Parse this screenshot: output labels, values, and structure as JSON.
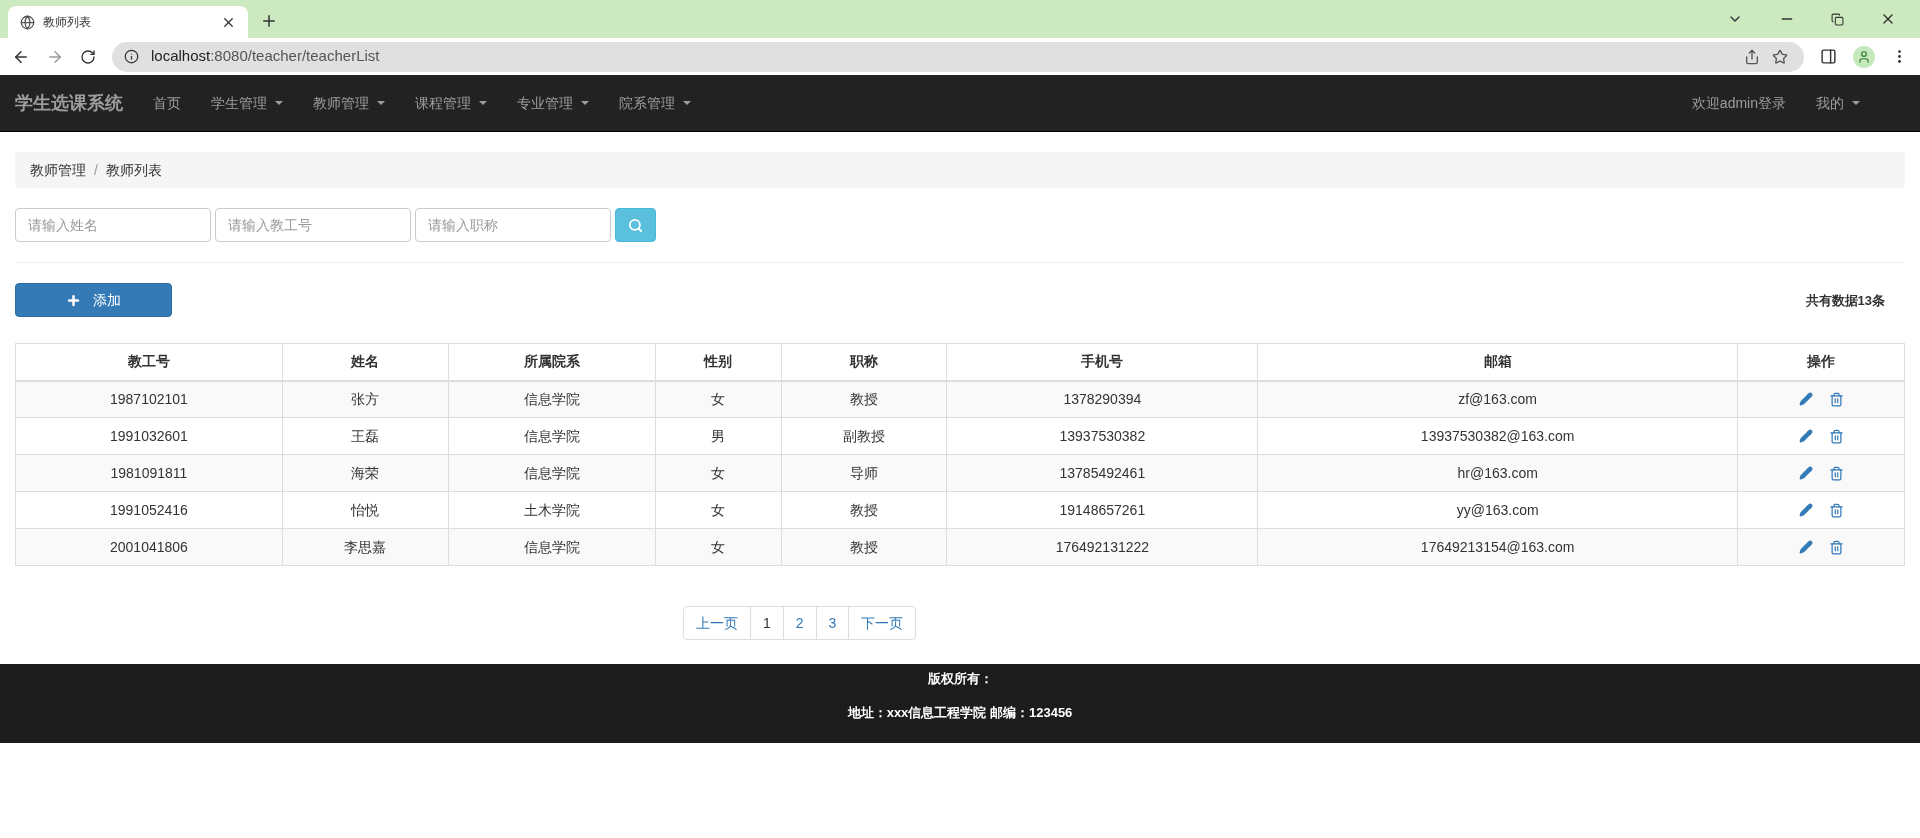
{
  "browser": {
    "tab_title": "教师列表",
    "url_host": "localhost",
    "url_path": ":8080/teacher/teacherList"
  },
  "navbar": {
    "brand": "学生选课系统",
    "items": [
      {
        "label": "首页",
        "dropdown": false
      },
      {
        "label": "学生管理",
        "dropdown": true
      },
      {
        "label": "教师管理",
        "dropdown": true
      },
      {
        "label": "课程管理",
        "dropdown": true
      },
      {
        "label": "专业管理",
        "dropdown": true
      },
      {
        "label": "院系管理",
        "dropdown": true
      }
    ],
    "right_items": [
      {
        "label": "欢迎admin登录",
        "dropdown": false
      },
      {
        "label": "我的",
        "dropdown": true
      }
    ]
  },
  "breadcrumb": [
    "教师管理",
    "教师列表"
  ],
  "breadcrumb_separator": "/",
  "search": {
    "fields": [
      {
        "placeholder": "请输入姓名"
      },
      {
        "placeholder": "请输入教工号"
      },
      {
        "placeholder": "请输入职称"
      }
    ]
  },
  "add_button": "添加",
  "total": "共有数据13条",
  "table": {
    "columns": [
      "教工号",
      "姓名",
      "所属院系",
      "性别",
      "职称",
      "手机号",
      "邮箱",
      "操作"
    ],
    "rows": [
      [
        "1987102101",
        "张方",
        "信息学院",
        "女",
        "教授",
        "1378290394",
        "zf@163.com"
      ],
      [
        "1991032601",
        "王磊",
        "信息学院",
        "男",
        "副教授",
        "13937530382",
        "13937530382@163.com"
      ],
      [
        "1981091811",
        "海荣",
        "信息学院",
        "女",
        "导师",
        "13785492461",
        "hr@163.com"
      ],
      [
        "1991052416",
        "怡悦",
        "土木学院",
        "女",
        "教授",
        "19148657261",
        "yy@163.com"
      ],
      [
        "2001041806",
        "李思嘉",
        "信息学院",
        "女",
        "教授",
        "176492131222",
        "17649213154@163.com"
      ]
    ]
  },
  "pagination": [
    {
      "label": "上一页",
      "selected": false
    },
    {
      "label": "1",
      "selected": true
    },
    {
      "label": "2",
      "selected": false
    },
    {
      "label": "3",
      "selected": false
    },
    {
      "label": "下一页",
      "selected": false
    }
  ],
  "footer": [
    "版权所有：",
    "地址：xxx信息工程学院 邮编：123456"
  ]
}
